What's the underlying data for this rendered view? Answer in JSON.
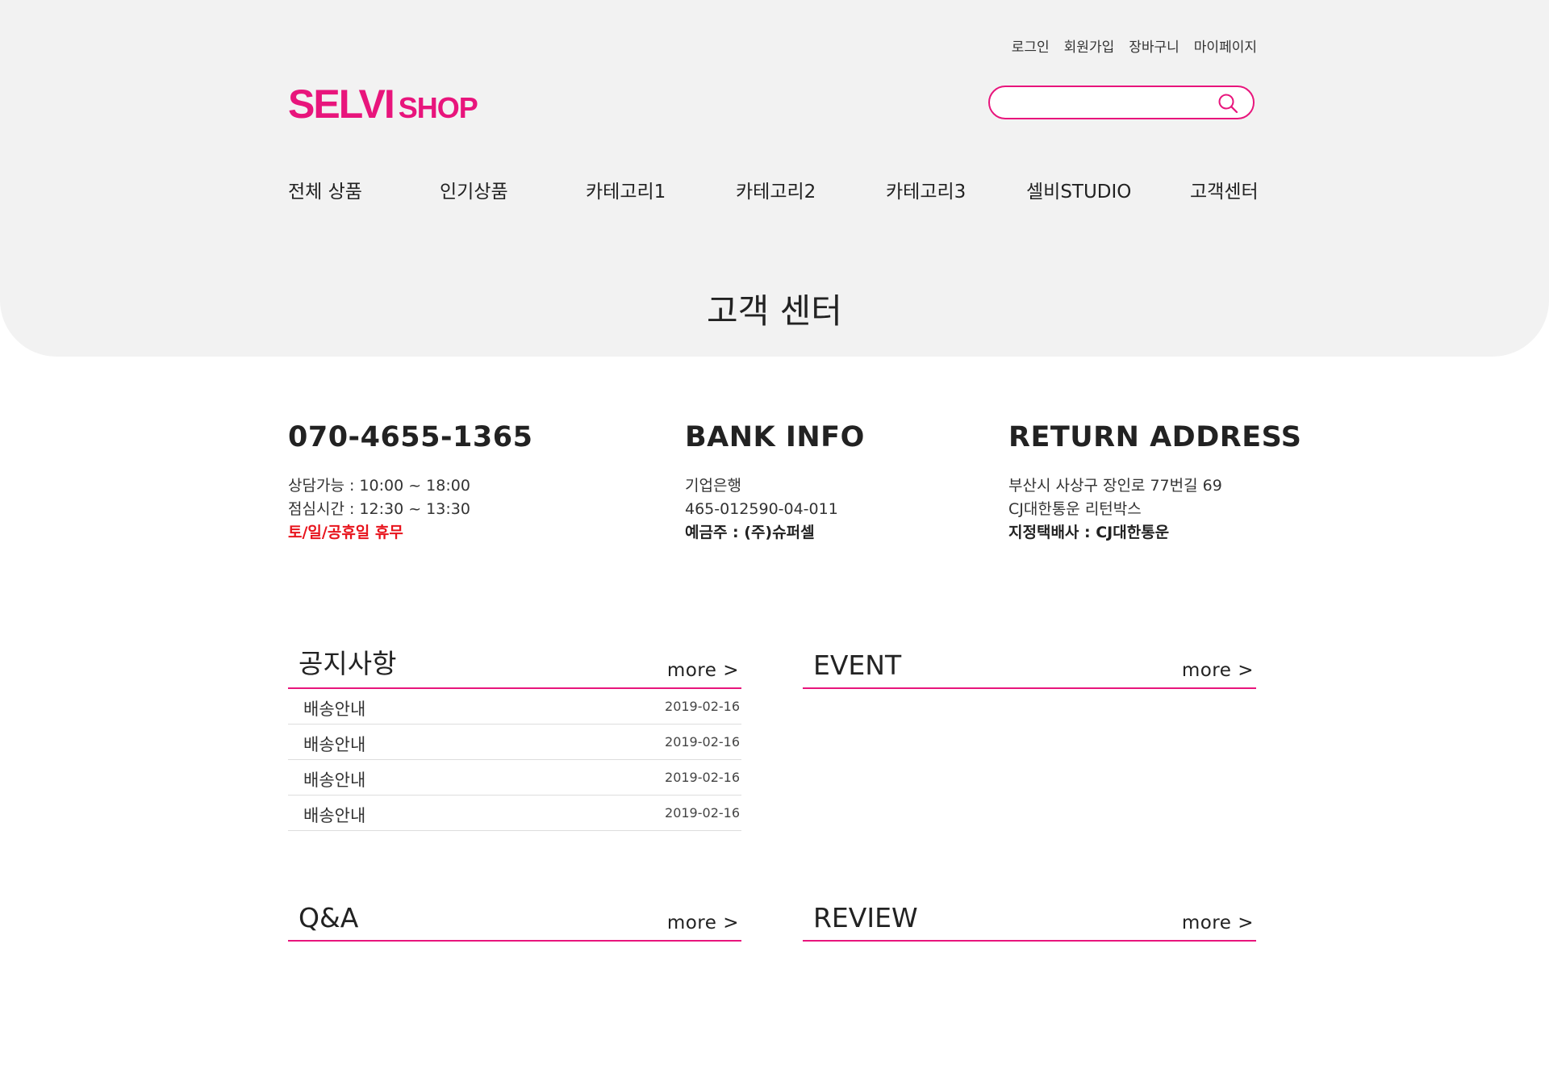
{
  "top_links": [
    "로그인",
    "회원가입",
    "장바구니",
    "마이페이지"
  ],
  "logo": {
    "main": "SELVI",
    "sub": "SHOP"
  },
  "search": {
    "placeholder": ""
  },
  "nav": [
    "전체 상품",
    "인기상품",
    "카테고리1",
    "카테고리2",
    "카테고리3",
    "셀비STUDIO",
    "고객센터"
  ],
  "page_title": "고객 센터",
  "contact": {
    "phone": "070-4655-1365",
    "hours": "상담가능 : 10:00 ~ 18:00",
    "lunch": "점심시간 : 12:30 ~ 13:30",
    "closed": "토/일/공휴일 휴무"
  },
  "bank": {
    "title": "BANK INFO",
    "bank_name": "기업은행",
    "account": "465-012590-04-011",
    "holder": "예금주 : (주)슈퍼셀"
  },
  "return_address": {
    "title": "RETURN ADDRESS",
    "address": "부산시 사상구 장인로 77번길 69",
    "recipient": "CJ대한통운 리턴박스",
    "courier": "지정택배사 : CJ대한통운"
  },
  "boards": {
    "notice": {
      "title": "공지사항",
      "more": "more >",
      "rows": [
        {
          "title": "배송안내",
          "date": "2019-02-16"
        },
        {
          "title": "배송안내",
          "date": "2019-02-16"
        },
        {
          "title": "배송안내",
          "date": "2019-02-16"
        },
        {
          "title": "배송안내",
          "date": "2019-02-16"
        }
      ]
    },
    "event": {
      "title": "EVENT",
      "more": "more >"
    },
    "qna": {
      "title": "Q&A",
      "more": "more >"
    },
    "review": {
      "title": "REVIEW",
      "more": "more >"
    }
  },
  "colors": {
    "brand": "#e8157c",
    "hero_bg": "#f2f2f2",
    "alert": "#e8131c"
  }
}
